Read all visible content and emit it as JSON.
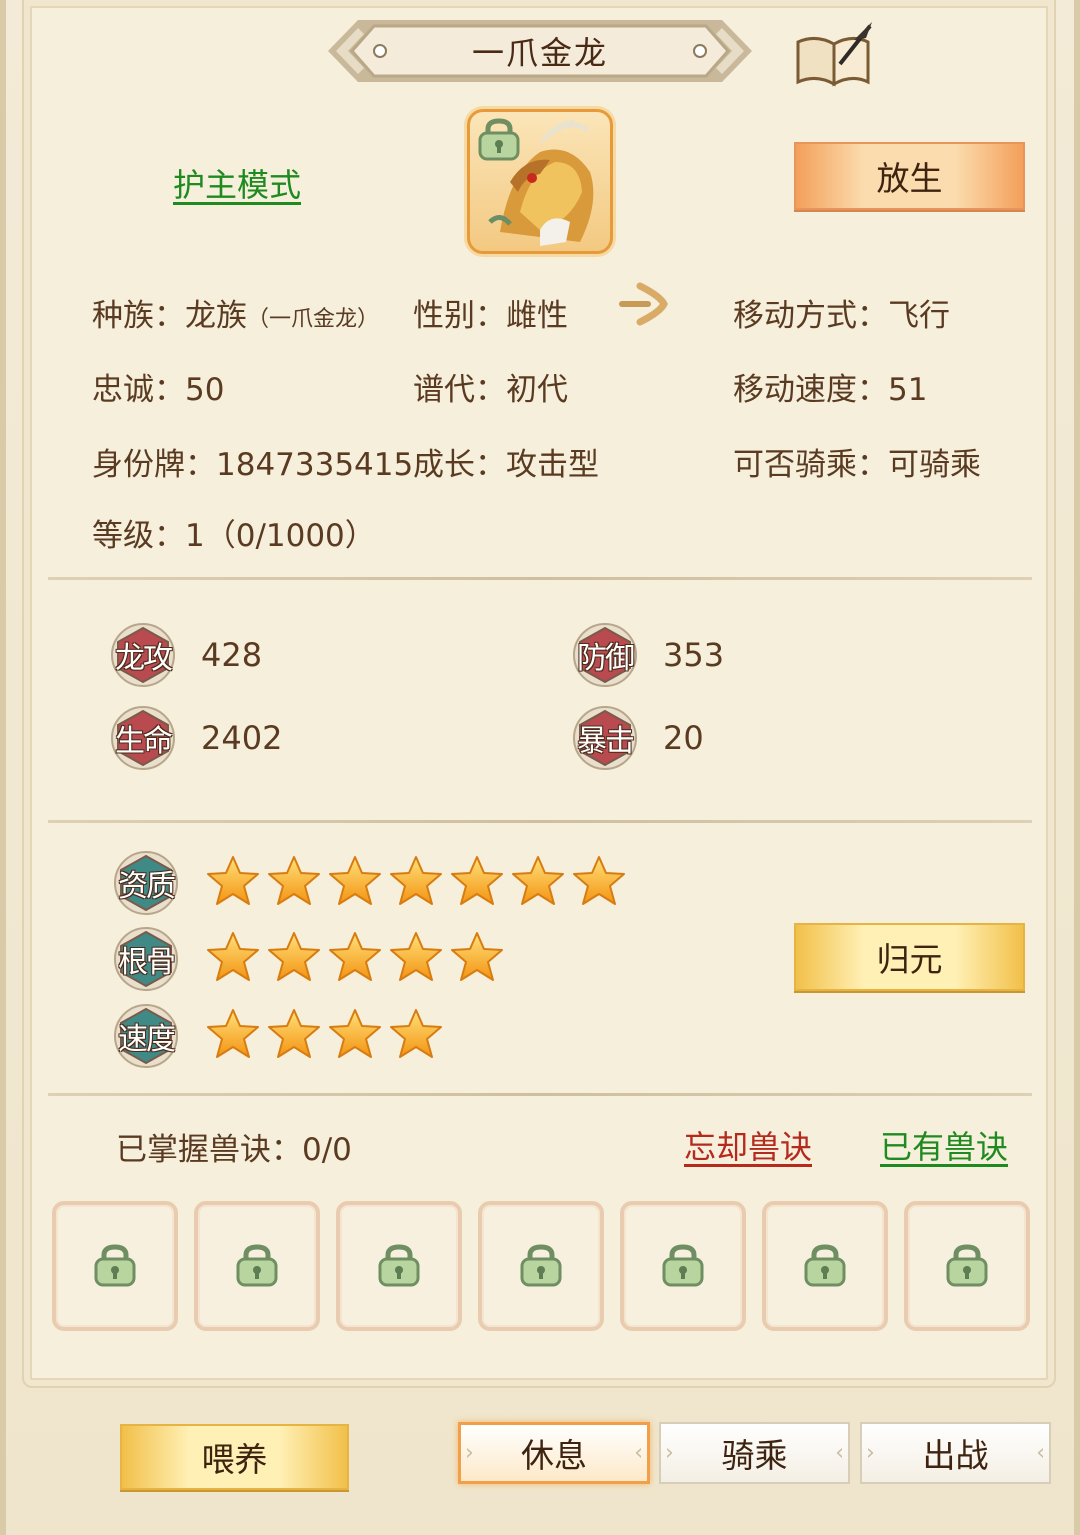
{
  "title": "一爪金龙",
  "icons": {
    "banner": "ornate-title-banner",
    "book": "book-quill-icon",
    "avatar": "golden-dragon-portrait",
    "lock": "lock-icon",
    "arrow": "arrow-right-icon",
    "star": "star-icon"
  },
  "header": {
    "guard_mode_link": "护主模式",
    "release_button": "放生"
  },
  "info": {
    "race_label": "种族：龙族",
    "race_sub": "（一爪金龙）",
    "gender": "性别：雌性",
    "move_type": "移动方式：飞行",
    "loyalty": "忠诚：50",
    "generation": "谱代：初代",
    "move_speed": "移动速度：51",
    "id_tag": "身份牌：1847335415",
    "growth": "成长：攻击型",
    "rideable": "可否骑乘：可骑乘",
    "level": "等级：1（0/1000）"
  },
  "stats": [
    {
      "label": "龙攻",
      "value": "428"
    },
    {
      "label": "防御",
      "value": "353"
    },
    {
      "label": "生命",
      "value": "2402"
    },
    {
      "label": "暴击",
      "value": "20"
    }
  ],
  "ratings": [
    {
      "label": "资质",
      "stars": 7
    },
    {
      "label": "根骨",
      "stars": 5
    },
    {
      "label": "速度",
      "stars": 4
    }
  ],
  "restore_button": "归元",
  "skills": {
    "mastered": "已掌握兽诀：0/0",
    "forget_link": "忘却兽诀",
    "owned_link": "已有兽诀",
    "slots_locked": 7
  },
  "footer": {
    "feed_button": "喂养",
    "tabs": [
      "休息",
      "骑乘",
      "出战"
    ],
    "active_tab": "休息"
  },
  "colors": {
    "background": "#f6efdc",
    "link_green": "#1f8a1f",
    "link_red": "#b42a1d",
    "badge_red": "#b84a50",
    "badge_teal": "#3f8a86",
    "star_gold": "#f7a21c"
  }
}
